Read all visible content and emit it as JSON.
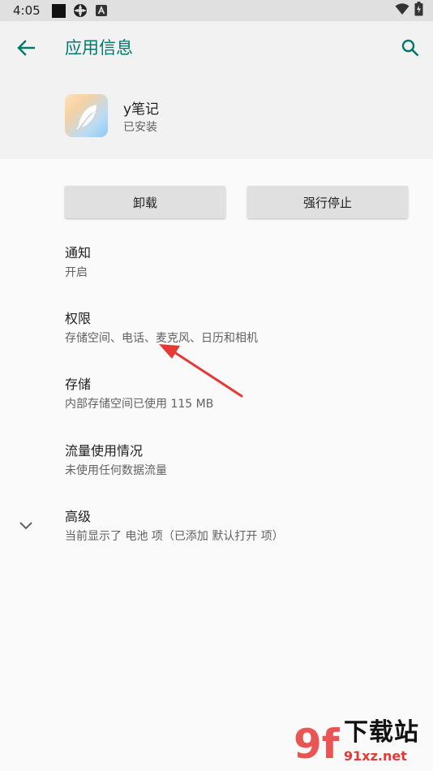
{
  "status_bar": {
    "time": "4:05",
    "icons": [
      "black-square-icon",
      "settings-flower-icon",
      "letter-a-icon"
    ],
    "right_icons": [
      "wifi-icon",
      "battery-icon"
    ]
  },
  "header": {
    "title": "应用信息",
    "app_name": "y笔记",
    "app_status": "已安装"
  },
  "buttons": {
    "uninstall": "卸载",
    "force_stop": "强行停止"
  },
  "prefs": [
    {
      "title": "通知",
      "summary": "开启"
    },
    {
      "title": "权限",
      "summary": "存储空间、电话、麦克风、日历和相机"
    },
    {
      "title": "存储",
      "summary": "内部存储空间已使用 115 MB"
    },
    {
      "title": "流量使用情况",
      "summary": "未使用任何数据流量"
    },
    {
      "title": "高级",
      "summary": "当前显示了 电池 项（已添加 默认打开 项）"
    }
  ],
  "watermark": {
    "logo": "9f",
    "name": "下载站",
    "url": "91xz.net"
  },
  "colors": {
    "accent": "#00796b",
    "annotation_arrow": "#e53935"
  }
}
